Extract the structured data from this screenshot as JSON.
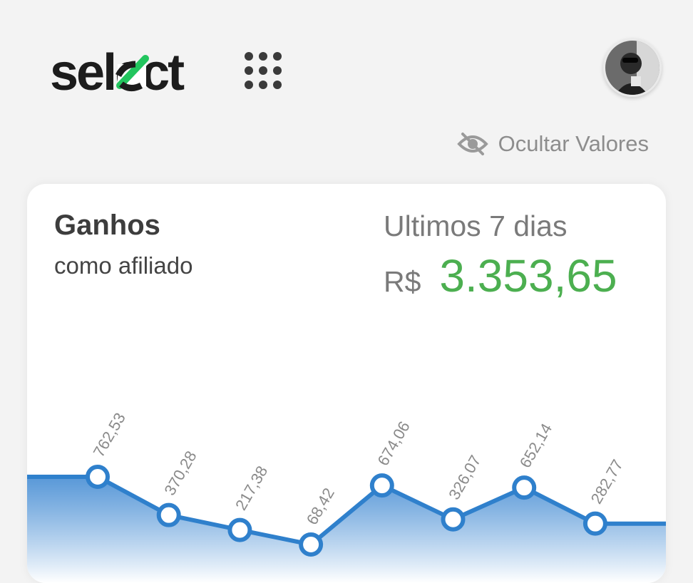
{
  "header": {
    "logo_text": "select",
    "apps_icon": "grid-apps-icon",
    "avatar_icon": "user-avatar"
  },
  "toolbar": {
    "hide_values_label": "Ocultar Valores",
    "hide_values_icon": "eye-off-icon"
  },
  "earnings_card": {
    "title": "Ganhos",
    "subtitle": "como afiliado",
    "period_label": "Ultimos 7 dias",
    "currency": "R$",
    "total": "3.353,65"
  },
  "colors": {
    "accent_green": "#4caf50",
    "logo_check_green": "#22c55e",
    "line_blue": "#2f80cc",
    "text_dark": "#3d3d3d",
    "text_muted": "#8d8d8d"
  },
  "chart_data": {
    "type": "line",
    "values": [
      762.53,
      370.28,
      217.38,
      68.42,
      674.06,
      326.07,
      652.14,
      282.77
    ],
    "data_labels": [
      "762,53",
      "370,28",
      "217,38",
      "68,42",
      "674,06",
      "326,07",
      "652,14",
      "282,77"
    ],
    "ylim": [
      0,
      800
    ],
    "grid": false,
    "legend": "none",
    "fill": "gradient-area"
  }
}
